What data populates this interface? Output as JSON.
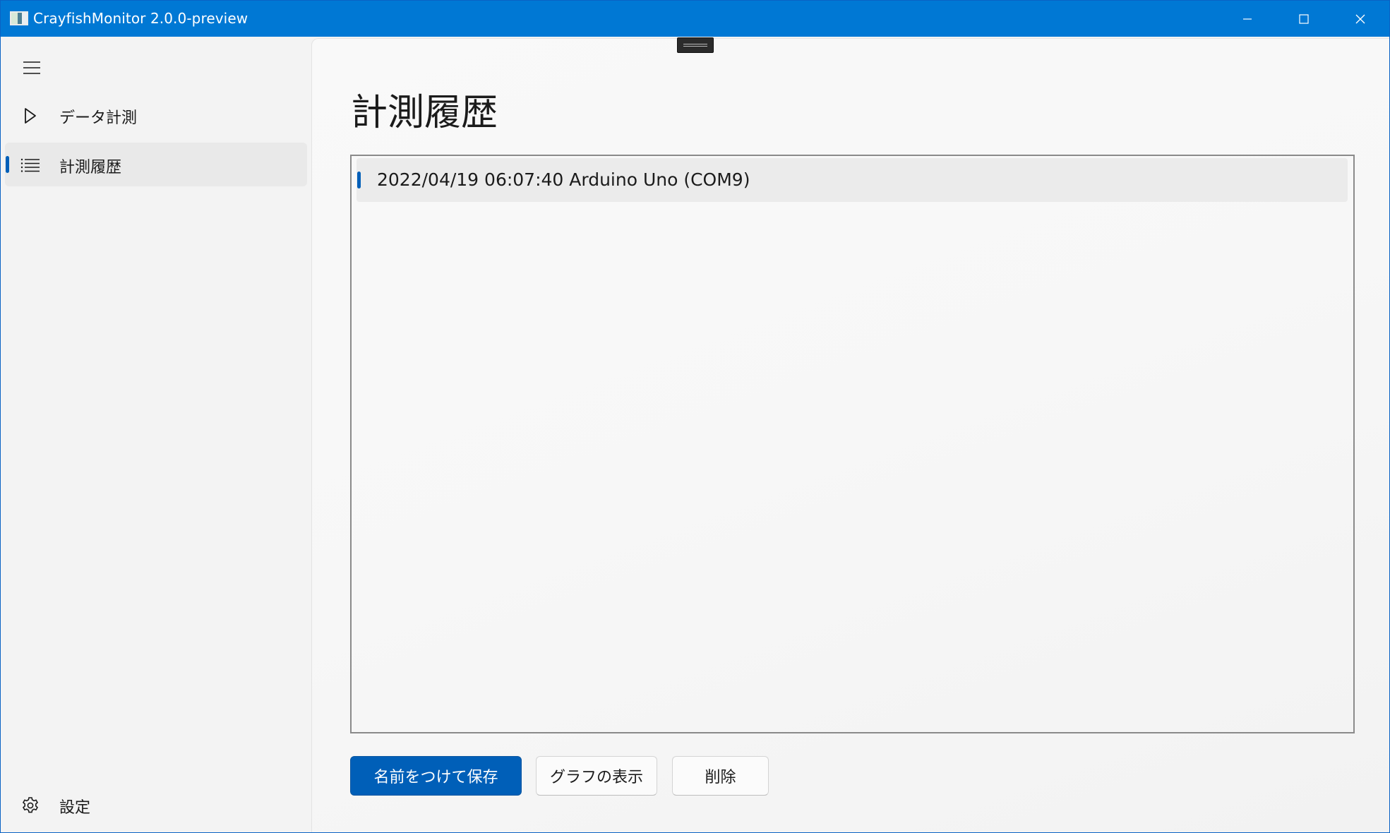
{
  "window": {
    "title": "CrayfishMonitor 2.0.0-preview",
    "accent_color": "#0078d4"
  },
  "nav": {
    "menu_icon": "hamburger-icon",
    "items": [
      {
        "label": "データ計測",
        "icon": "play-icon",
        "selected": false
      },
      {
        "label": "計測履歴",
        "icon": "list-icon",
        "selected": true
      }
    ],
    "settings": {
      "label": "設定",
      "icon": "gear-icon"
    }
  },
  "page": {
    "title": "計測履歴",
    "history": [
      {
        "text": "2022/04/19 06:07:40 Arduino Uno (COM9)",
        "selected": true
      }
    ],
    "buttons": {
      "save_as": "名前をつけて保存",
      "show_graph": "グラフの表示",
      "delete": "削除"
    },
    "primary_color": "#005fb8"
  }
}
